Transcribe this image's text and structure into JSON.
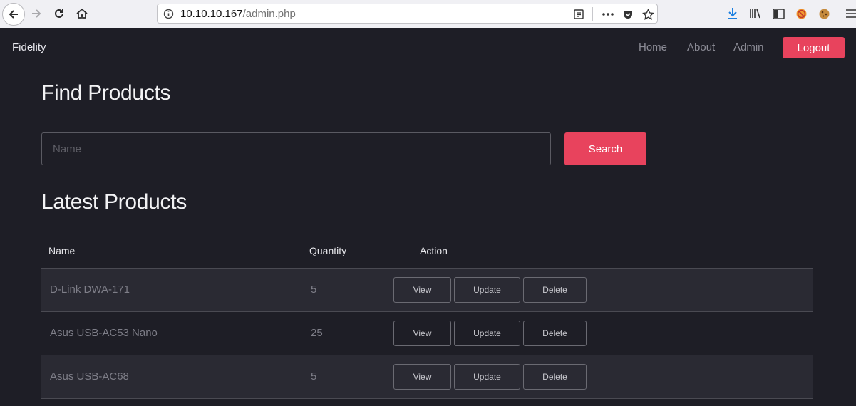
{
  "browser": {
    "url_host": "10.10.10.167",
    "url_path": "/admin.php"
  },
  "nav": {
    "brand": "Fidelity",
    "links": [
      "Home",
      "About",
      "Admin"
    ],
    "logout": "Logout"
  },
  "search": {
    "heading": "Find Products",
    "placeholder": "Name",
    "button": "Search"
  },
  "products": {
    "heading": "Latest Products",
    "columns": [
      "Name",
      "Quantity",
      "Action"
    ],
    "actions": [
      "View",
      "Update",
      "Delete"
    ],
    "rows": [
      {
        "name": "D-Link DWA-171",
        "quantity": "5"
      },
      {
        "name": "Asus USB-AC53 Nano",
        "quantity": "25"
      },
      {
        "name": "Asus USB-AC68",
        "quantity": "5"
      }
    ]
  },
  "colors": {
    "accent": "#e8435d",
    "background": "#1e1e26",
    "row_alt": "#2a2a33"
  }
}
